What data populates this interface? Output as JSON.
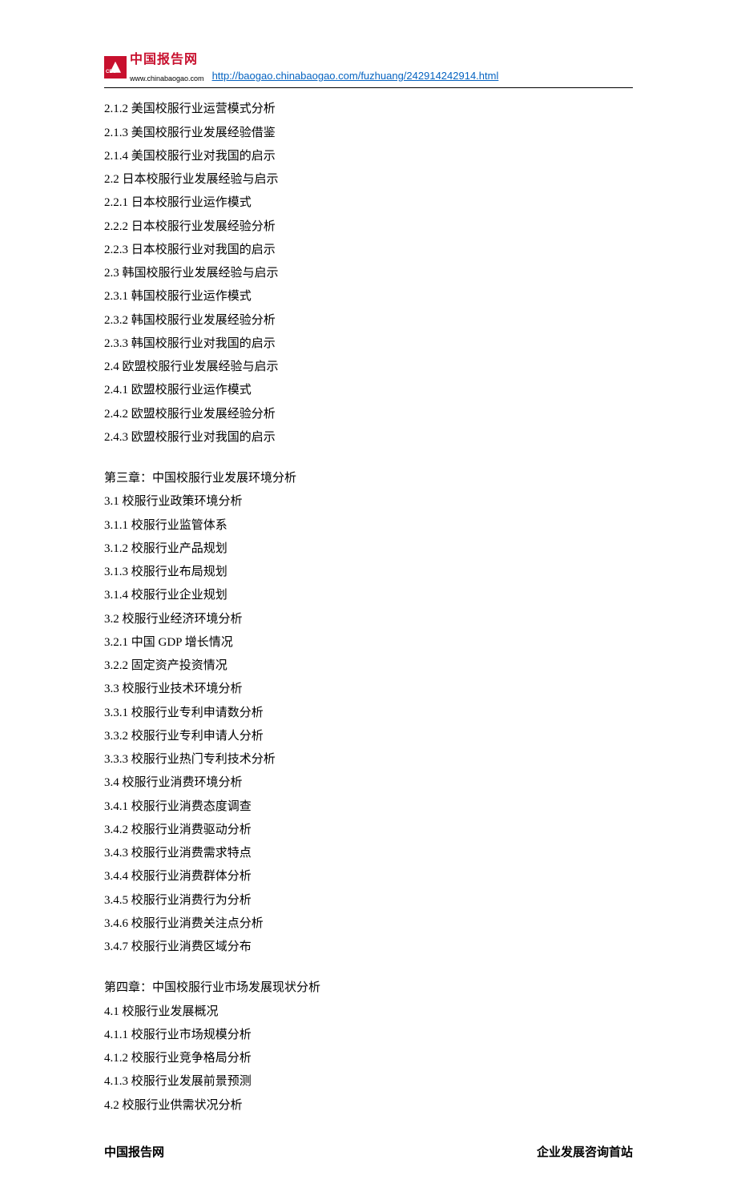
{
  "header": {
    "logo_cn": "中国报告网",
    "logo_url": "www.chinabaogao.com",
    "link": "http://baogao.chinabaogao.com/fuzhuang/242914242914.html"
  },
  "toc": {
    "section2": [
      "2.1.2 美国校服行业运营模式分析",
      "2.1.3 美国校服行业发展经验借鉴",
      "2.1.4 美国校服行业对我国的启示",
      "2.2 日本校服行业发展经验与启示",
      "2.2.1 日本校服行业运作模式",
      "2.2.2 日本校服行业发展经验分析",
      "2.2.3 日本校服行业对我国的启示",
      "2.3 韩国校服行业发展经验与启示",
      "2.3.1 韩国校服行业运作模式",
      "2.3.2 韩国校服行业发展经验分析",
      "2.3.3 韩国校服行业对我国的启示",
      "2.4 欧盟校服行业发展经验与启示",
      "2.4.1 欧盟校服行业运作模式",
      "2.4.2 欧盟校服行业发展经验分析",
      "2.4.3 欧盟校服行业对我国的启示"
    ],
    "chapter3_title": "第三章：中国校服行业发展环境分析",
    "section3": [
      "3.1 校服行业政策环境分析",
      "3.1.1 校服行业监管体系",
      "3.1.2 校服行业产品规划",
      "3.1.3 校服行业布局规划",
      "3.1.4 校服行业企业规划",
      "3.2 校服行业经济环境分析",
      "3.2.1 中国 GDP 增长情况",
      "3.2.2 固定资产投资情况",
      "3.3 校服行业技术环境分析",
      "3.3.1 校服行业专利申请数分析",
      "3.3.2 校服行业专利申请人分析",
      "3.3.3 校服行业热门专利技术分析",
      "3.4 校服行业消费环境分析",
      "3.4.1 校服行业消费态度调查",
      "3.4.2 校服行业消费驱动分析",
      "3.4.3 校服行业消费需求特点",
      "3.4.4 校服行业消费群体分析",
      "3.4.5 校服行业消费行为分析",
      "3.4.6 校服行业消费关注点分析",
      "3.4.7 校服行业消费区域分布"
    ],
    "chapter4_title": "第四章：中国校服行业市场发展现状分析",
    "section4": [
      "4.1 校服行业发展概况",
      "4.1.1 校服行业市场规模分析",
      "4.1.2 校服行业竞争格局分析",
      "4.1.3 校服行业发展前景预测",
      "4.2 校服行业供需状况分析"
    ]
  },
  "footer": {
    "left": "中国报告网",
    "right": "企业发展咨询首站"
  }
}
